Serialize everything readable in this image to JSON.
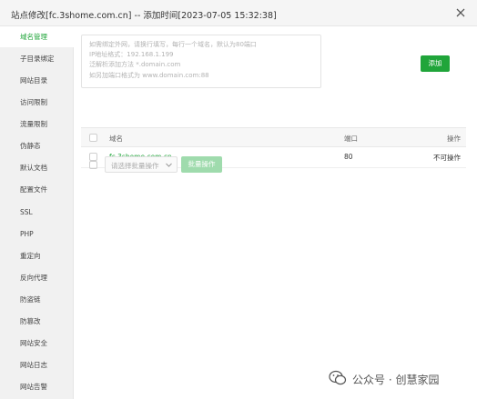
{
  "window": {
    "title": "站点修改[fc.3shome.com.cn] -- 添加时间[2023-07-05 15:32:38]"
  },
  "sidebar": {
    "items": [
      {
        "label": "域名管理",
        "active": true
      },
      {
        "label": "子目录绑定",
        "active": false
      },
      {
        "label": "网站目录",
        "active": false
      },
      {
        "label": "访问限制",
        "active": false
      },
      {
        "label": "流量限制",
        "active": false
      },
      {
        "label": "伪静态",
        "active": false
      },
      {
        "label": "默认文档",
        "active": false
      },
      {
        "label": "配置文件",
        "active": false
      },
      {
        "label": "SSL",
        "active": false
      },
      {
        "label": "PHP",
        "active": false
      },
      {
        "label": "重定向",
        "active": false
      },
      {
        "label": "反向代理",
        "active": false
      },
      {
        "label": "防盗链",
        "active": false
      },
      {
        "label": "防篡改",
        "active": false
      },
      {
        "label": "网站安全",
        "active": false
      },
      {
        "label": "网站日志",
        "active": false
      },
      {
        "label": "网站告警",
        "active": false
      }
    ]
  },
  "domain_input": {
    "placeholder_lines": [
      "如需绑定外网，请换行填写，每行一个域名，默认为80端口",
      "IP地址格式：192.168.1.199",
      "泛解析添加方法 *.domain.com",
      "如另加端口格式为 www.domain.com:88"
    ]
  },
  "add_button": {
    "label": "添加"
  },
  "table": {
    "headers": {
      "name": "域名",
      "port": "端口",
      "operation": "操作"
    },
    "rows": [
      {
        "name": "fc.3shome.com.cn",
        "port": "80",
        "operation": "不可操作"
      }
    ]
  },
  "batch": {
    "select_placeholder": "请选择批量操作",
    "button_label": "批量操作"
  },
  "watermark": {
    "text": "公众号 · 创慧家园"
  },
  "colors": {
    "accent": "#20a53a",
    "accent_disabled": "#9fdbad"
  }
}
